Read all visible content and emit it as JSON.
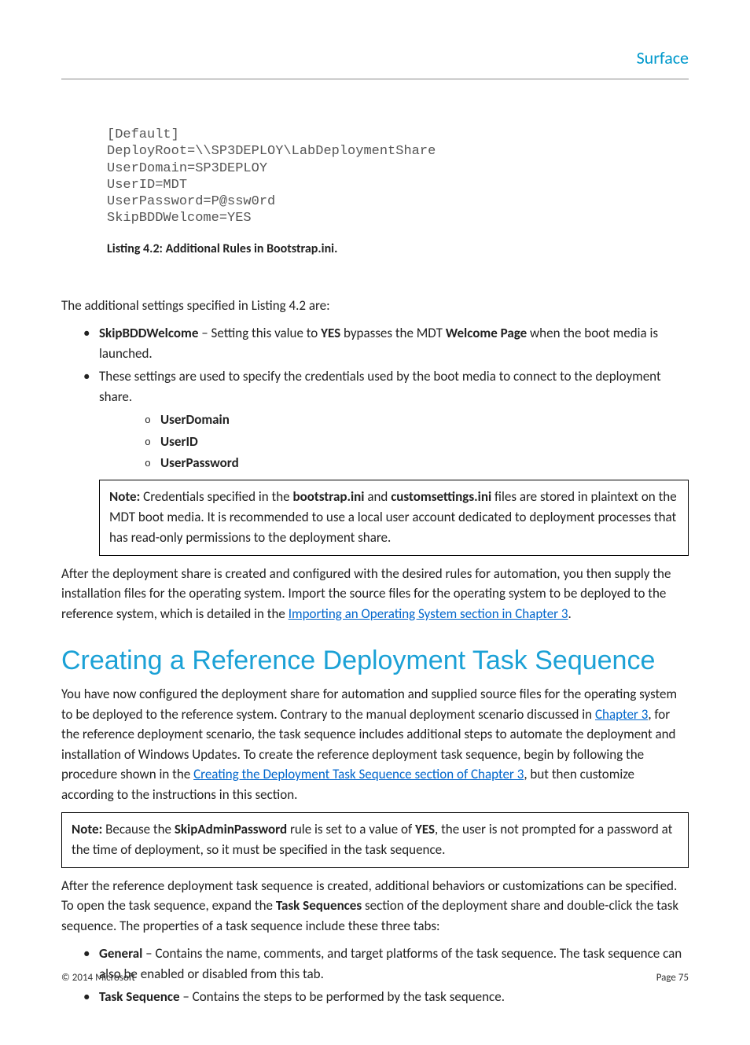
{
  "brand": "Surface",
  "code_block": "[Default]\nDeployRoot=\\\\SP3DEPLOY\\LabDeploymentShare\nUserDomain=SP3DEPLOY\nUserID=MDT\nUserPassword=P@ssw0rd\nSkipBDDWelcome=YES",
  "listing_caption": "Listing 4.2: Additional Rules in Bootstrap.ini.",
  "intro_para": "The additional settings specified in Listing 4.2 are:",
  "bullet1": {
    "b1": "SkipBDDWelcome",
    "t1": " – Setting this value to ",
    "b2": "YES",
    "t2": " bypasses the MDT ",
    "b3": "Welcome Page",
    "t3": " when the boot media is launched."
  },
  "bullet2": "These settings are used to specify the credentials used by the boot media to connect to the deployment share.",
  "sub_items": [
    "UserDomain",
    "UserID",
    "UserPassword"
  ],
  "note1": {
    "lbl": "Note:",
    "t1": " Credentials specified in the ",
    "b1": "bootstrap.ini",
    "t2": " and ",
    "b2": "customsettings.ini",
    "t3": " files are stored in plaintext on the MDT boot media. It is recommended to use a local user account dedicated to deployment processes that has read-only permissions to the deployment share."
  },
  "after_note1": {
    "t1": "After the deployment share is created and configured with the desired rules for automation, you then supply the installation files for the operating system. Import the source files for the operating system to be deployed to the reference system, which is detailed in the ",
    "link": "Importing an Operating System section in Chapter 3",
    "t2": "."
  },
  "heading": "Creating a Reference Deployment Task Sequence",
  "section_para": {
    "t1": "You have now configured the deployment share for automation and supplied source files for the operating system to be deployed to the reference system. Contrary to the manual deployment scenario discussed in ",
    "link1": "Chapter 3",
    "t2": ", for the reference deployment scenario, the task sequence includes additional steps to automate the deployment and installation of Windows Updates. To create the reference deployment task sequence, begin by following the procedure shown in the ",
    "link2": "Creating the Deployment Task Sequence section of Chapter 3",
    "t3": ", but then customize according to the instructions in this section."
  },
  "note2": {
    "lbl": "Note:",
    "t1": " Because the ",
    "b1": "SkipAdminPassword",
    "t2": " rule is set to a value of ",
    "b2": "YES",
    "t3": ", the user is not prompted for a password at the time of deployment, so it must be specified in the task sequence."
  },
  "after_note2": {
    "t1": "After the reference deployment task sequence is created, additional behaviors or customizations can be specified. To open the task sequence, expand the ",
    "b1": "Task Sequences",
    "t2": " section of the deployment share and double-click the task sequence. The properties of a task sequence include these three tabs:"
  },
  "tabs_list": [
    {
      "b": "General",
      "t": " – Contains the name, comments, and target platforms of the task sequence. The task sequence can also be enabled or disabled from this tab."
    },
    {
      "b": "Task Sequence",
      "t": " – Contains the steps to be performed by the task sequence."
    }
  ],
  "footer": {
    "copyright": "© 2014 Microsoft",
    "page": "Page 75"
  }
}
